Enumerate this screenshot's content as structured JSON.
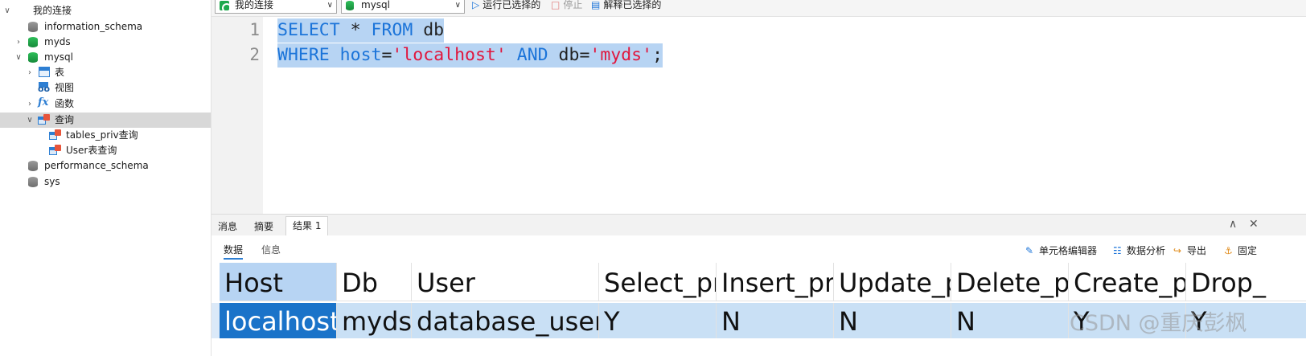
{
  "nav": {
    "items": [
      {
        "label": "我的连接",
        "icon": "connection-icon"
      },
      {
        "label": "information_schema",
        "icon": "database-icon"
      },
      {
        "label": "myds",
        "icon": "database-icon"
      },
      {
        "label": "mysql",
        "icon": "database-icon"
      },
      {
        "label": "表",
        "icon": "table-icon"
      },
      {
        "label": "视图",
        "icon": "view-icon"
      },
      {
        "label": "函数",
        "icon": "function-icon"
      },
      {
        "label": "查询",
        "icon": "query-icon"
      },
      {
        "label": "tables_priv查询",
        "icon": "query-icon"
      },
      {
        "label": "User表查询",
        "icon": "query-icon"
      },
      {
        "label": "performance_schema",
        "icon": "database-icon"
      },
      {
        "label": "sys",
        "icon": "database-icon"
      }
    ]
  },
  "toolbar": {
    "connection": "我的连接",
    "database": "mysql",
    "run_selected": "运行已选择的",
    "stop": "停止",
    "explain_selected": "解释已选择的"
  },
  "editor": {
    "line_numbers": [
      "1",
      "2"
    ],
    "line1": {
      "kw1": "SELECT",
      "star": " * ",
      "kw2": "FROM",
      "tbl": " db"
    },
    "line2": {
      "kw1": "WHERE",
      "col1": " host",
      "eq1": "=",
      "val1": "'localhost'",
      "kw2": " AND",
      "col2": " db",
      "eq2": "=",
      "val2": "'myds'",
      "end": ";"
    }
  },
  "panel": {
    "tabs": [
      "消息",
      "摘要",
      "结果 1"
    ],
    "subtabs": [
      "数据",
      "信息"
    ],
    "actions": {
      "cell_editor": "单元格编辑器",
      "data_analysis": "数据分析",
      "export": "导出",
      "pin": "固定"
    }
  },
  "grid": {
    "columns": [
      "Host",
      "Db",
      "User",
      "Select_pr",
      "Insert_pr",
      "Update_p",
      "Delete_p",
      "Create_p",
      "Drop_"
    ],
    "rows": [
      [
        "localhost",
        "myds",
        "database_user",
        "Y",
        "N",
        "N",
        "N",
        "Y",
        "Y"
      ]
    ]
  },
  "watermark": "CSDN @重庆彭枫",
  "colors": {
    "keyword": "#1b74d9",
    "string": "#e0163d",
    "selection": "#b7d4f3",
    "accent": "#1a73c9"
  }
}
